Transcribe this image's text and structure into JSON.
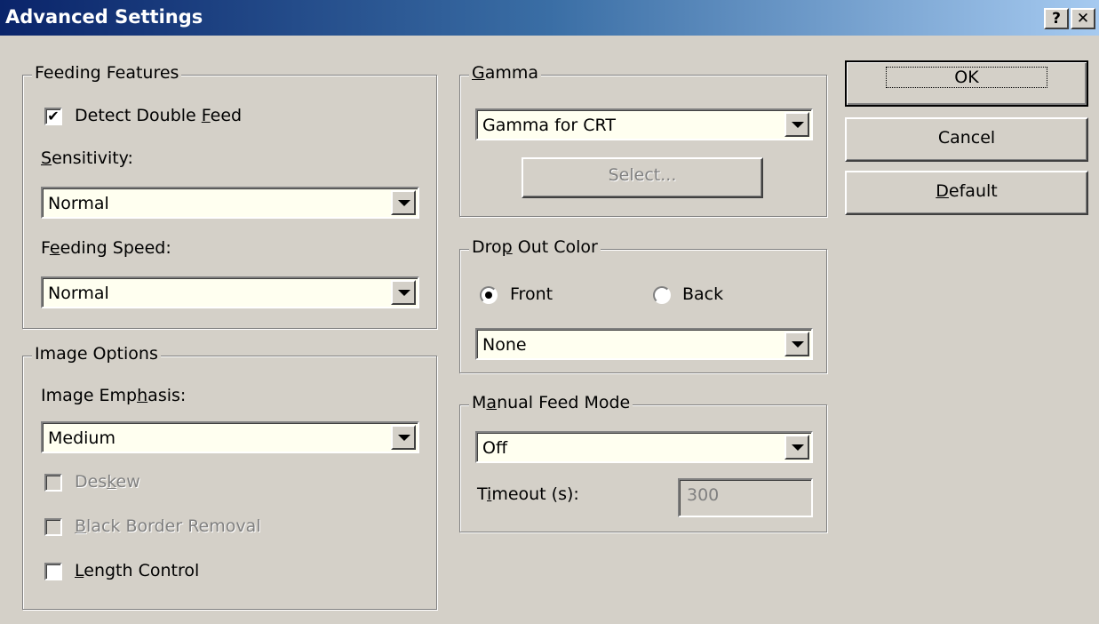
{
  "window": {
    "title": "Advanced Settings",
    "help_btn": "?",
    "close_btn": "✕"
  },
  "feeding": {
    "legend": "Feeding Features",
    "detect_double_feed": {
      "pre": "Detect Double ",
      "u": "F",
      "post": "eed",
      "checked": true
    },
    "sensitivity_label": {
      "u": "S",
      "post": "ensitivity:"
    },
    "sensitivity_value": "Normal",
    "speed_label": {
      "pre": "F",
      "u": "e",
      "post": "eding Speed:"
    },
    "speed_value": "Normal"
  },
  "image_options": {
    "legend": "Image Options",
    "emphasis_label": {
      "pre": "Image Emp",
      "u": "h",
      "post": "asis:"
    },
    "emphasis_value": "Medium",
    "deskew": {
      "pre": "Des",
      "u": "k",
      "post": "ew",
      "checked": false,
      "enabled": false
    },
    "black_border": {
      "u": "B",
      "post": "lack Border Removal",
      "checked": false,
      "enabled": false
    },
    "length_control": {
      "u": "L",
      "post": "ength Control",
      "checked": false,
      "enabled": true
    }
  },
  "gamma": {
    "legend": {
      "u": "G",
      "post": "amma"
    },
    "value": "Gamma for CRT",
    "select_btn": "Select..."
  },
  "dropout": {
    "legend": {
      "pre": "Dro",
      "u": "p",
      "post": " Out Color"
    },
    "front": "Front",
    "back": "Back",
    "selected": "Front",
    "value": "None"
  },
  "manual_feed": {
    "legend": {
      "pre": "M",
      "u": "a",
      "post": "nual Feed Mode"
    },
    "value": "Off",
    "timeout_label": {
      "pre": "T",
      "u": "i",
      "post": "meout (s):"
    },
    "timeout_value": "300"
  },
  "buttons": {
    "ok": "OK",
    "cancel": "Cancel",
    "default": {
      "u": "D",
      "post": "efault"
    }
  }
}
